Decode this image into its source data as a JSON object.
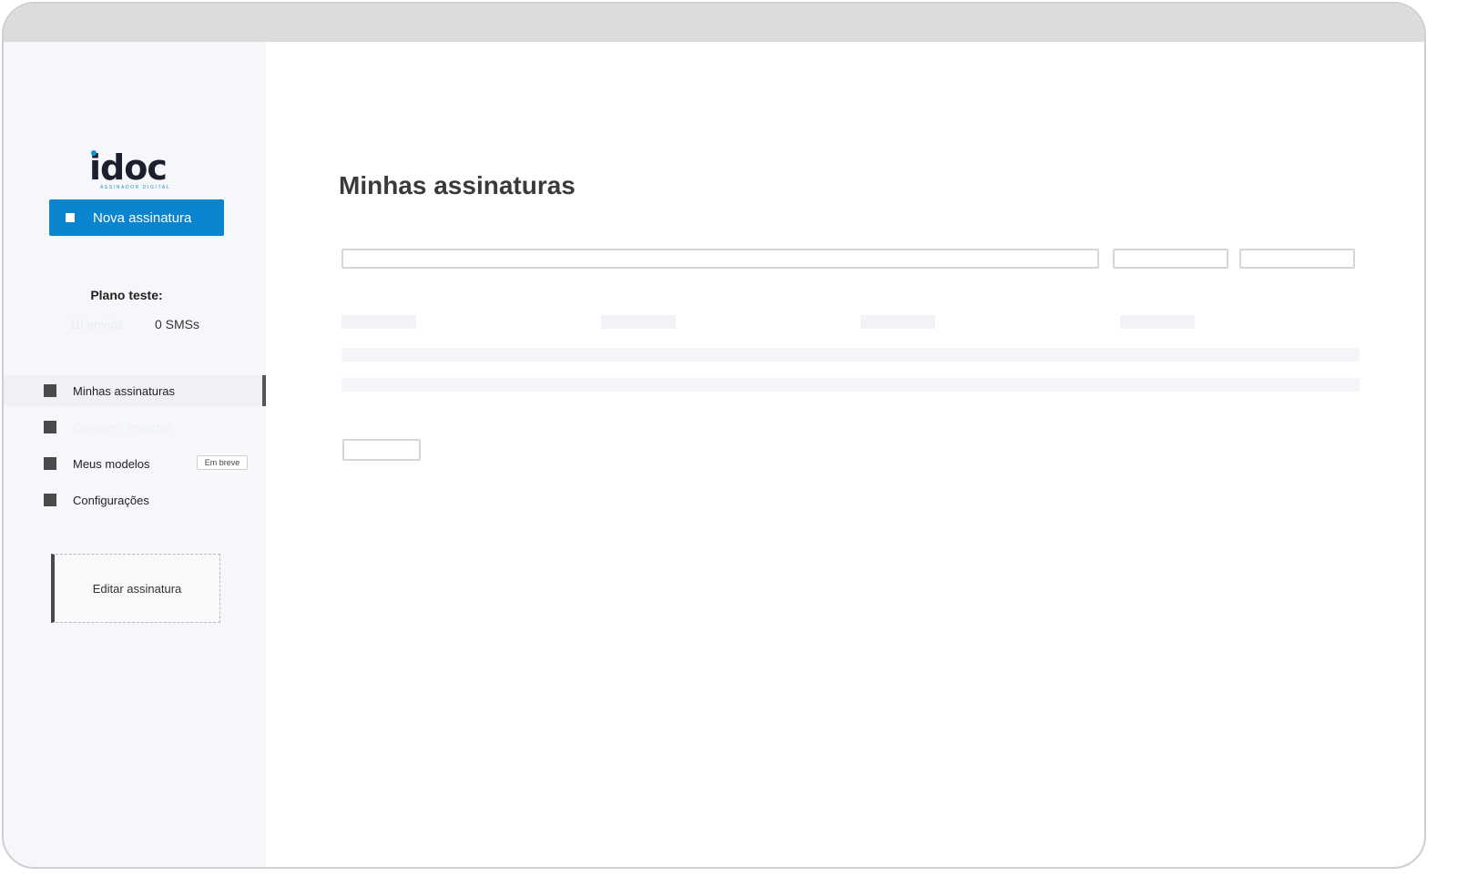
{
  "brand": {
    "logo_text": "idoc",
    "logo_subtitle": "ASSINADOR DIGITAL"
  },
  "sidebar": {
    "new_button_label": "Nova assinatura",
    "plan": {
      "title": "Plano teste:",
      "envios": "10 envios",
      "sms": "0 SMSs"
    },
    "items": [
      {
        "label": "Minhas assinaturas",
        "active": true
      },
      {
        "label": "Consumir importar",
        "faded": true
      },
      {
        "label": "Meus modelos",
        "badge": "Em breve"
      },
      {
        "label": "Configurações"
      }
    ],
    "edit_signature_label": "Editar assinatura"
  },
  "main": {
    "title": "Minhas assinaturas",
    "search": {
      "value": "",
      "placeholder": ""
    },
    "filter_1": {
      "value": ""
    },
    "filter_2": {
      "value": ""
    }
  },
  "colors": {
    "accent": "#0b84d0",
    "sidebar_bg": "#f6f7fa",
    "top_bar": "#dcdcdc"
  }
}
